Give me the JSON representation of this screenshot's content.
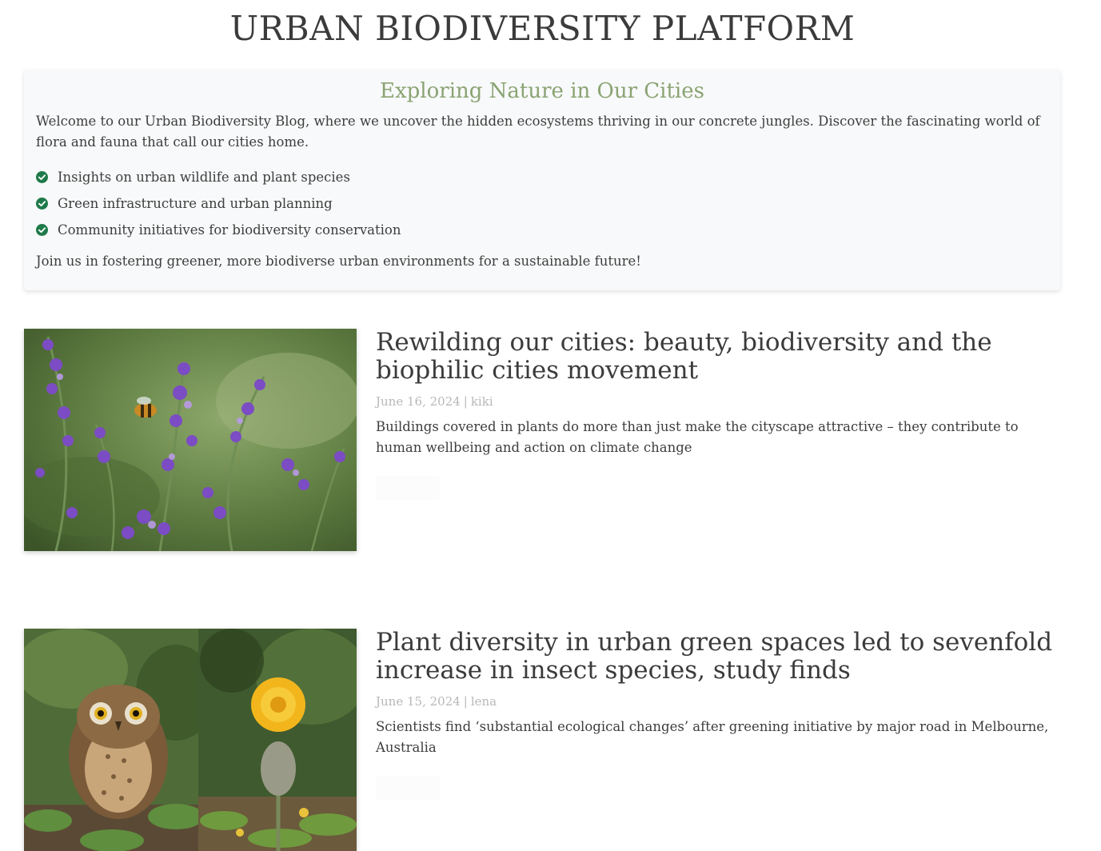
{
  "site": {
    "title": "URBAN BIODIVERSITY PLATFORM"
  },
  "intro": {
    "heading": "Exploring Nature in Our Cities",
    "text": "Welcome to our Urban Biodiversity Blog, where we uncover the hidden ecosystems thriving in our concrete jungles. Discover the fascinating world of flora and fauna that call our cities home.",
    "bullets": [
      {
        "label": "Insights on urban wildlife and plant species",
        "icon": "check-circle-icon"
      },
      {
        "label": "Green infrastructure and urban planning",
        "icon": "check-circle-icon"
      },
      {
        "label": "Community initiatives for biodiversity conservation",
        "icon": "check-circle-icon"
      }
    ],
    "footer": "Join us in fostering greener, more biodiverse urban environments for a sustainable future!"
  },
  "posts": [
    {
      "title": "Rewilding our cities: beauty, biodiversity and the biophilic cities movement",
      "date": "June 16, 2024",
      "separator": "|",
      "author": "kiki",
      "excerpt": "Buildings covered in plants do more than just make the cityscape attractive – they contribute to human wellbeing and action on climate change",
      "image": "lavender-bee-photo"
    },
    {
      "title": "Plant diversity in urban green spaces led to sevenfold increase in insect species, study finds",
      "date": "June 15, 2024",
      "separator": "|",
      "author": "lena",
      "excerpt": "Scientists find ‘substantial ecological changes’ after greening initiative by major road in Melbourne, Australia",
      "image": "owl-dandelion-photo"
    }
  ],
  "colors": {
    "accent": "#8aa372",
    "check": "#1e7a4a",
    "card_bg": "#f8f9fa",
    "meta": "#b8b8b8"
  }
}
